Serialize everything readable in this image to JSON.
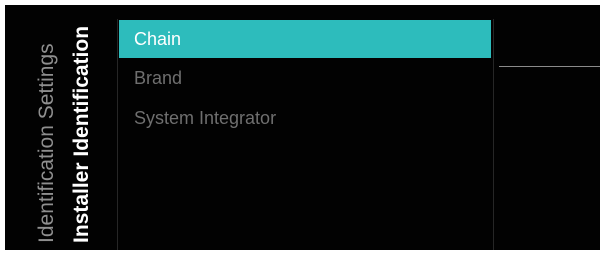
{
  "breadcrumb": {
    "parent": "Identification Settings",
    "current": "Installer Identification"
  },
  "menu": {
    "items": [
      {
        "label": "Chain",
        "selected": true
      },
      {
        "label": "Brand",
        "selected": false
      },
      {
        "label": "System Integrator",
        "selected": false
      }
    ]
  },
  "colors": {
    "background": "#020202",
    "selection": "#2dbcbc",
    "inactive_text": "#6f6f6f"
  }
}
